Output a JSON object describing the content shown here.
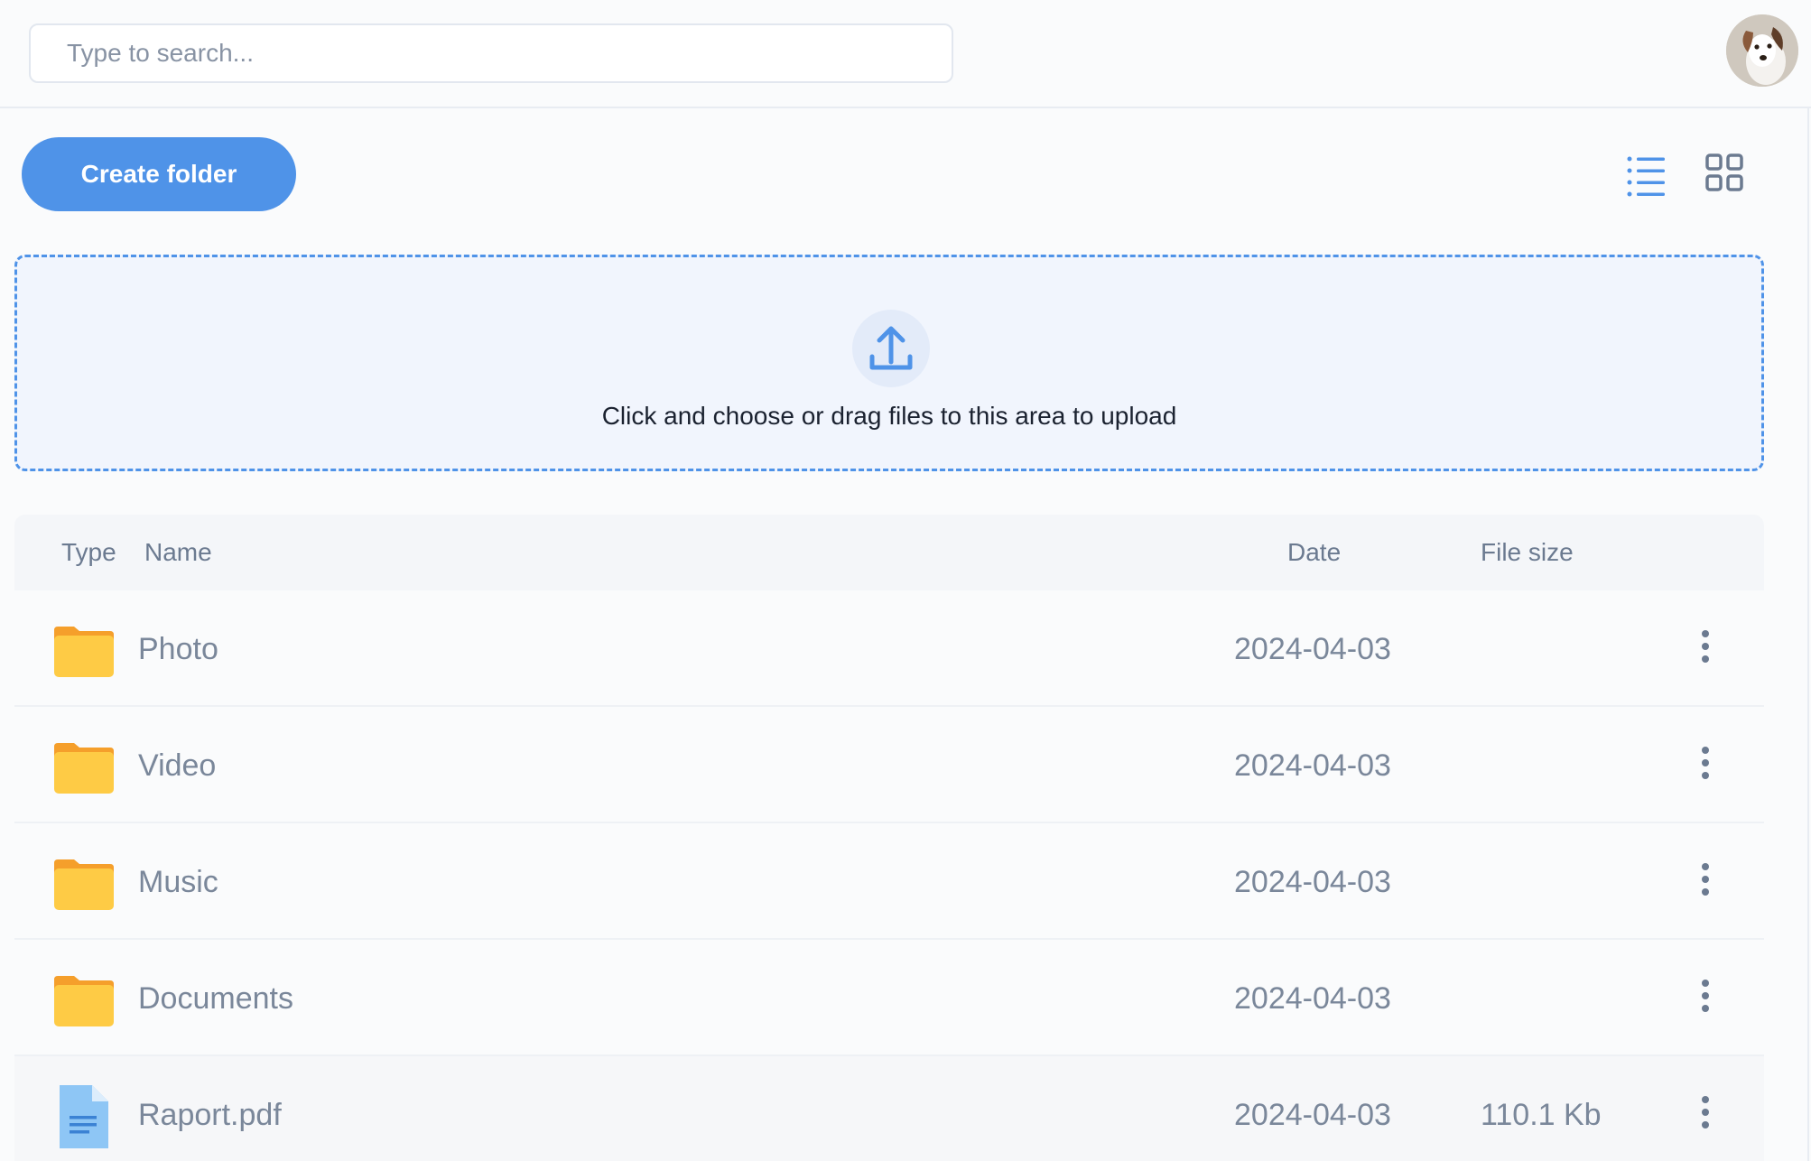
{
  "search": {
    "placeholder": "Type to search..."
  },
  "toolbar": {
    "create_folder_label": "Create folder"
  },
  "upload": {
    "text": "Click and choose or drag files to this area to upload"
  },
  "table": {
    "headers": {
      "type": "Type",
      "name": "Name",
      "date": "Date",
      "size": "File size"
    },
    "rows": [
      {
        "kind": "folder",
        "name": "Photo",
        "date": "2024-04-03",
        "size": ""
      },
      {
        "kind": "folder",
        "name": "Video",
        "date": "2024-04-03",
        "size": ""
      },
      {
        "kind": "folder",
        "name": "Music",
        "date": "2024-04-03",
        "size": ""
      },
      {
        "kind": "folder",
        "name": "Documents",
        "date": "2024-04-03",
        "size": ""
      },
      {
        "kind": "file",
        "name": "Raport.pdf",
        "date": "2024-04-03",
        "size": "110.1 Kb"
      }
    ]
  },
  "colors": {
    "accent": "#4f93e8",
    "folder": "#fecb45",
    "folder_tab": "#f59f2b",
    "file": "#8ec6f5"
  },
  "icons": {
    "list_view": "list-view-icon",
    "grid_view": "grid-view-icon",
    "upload": "upload-icon",
    "folder": "folder-icon",
    "file": "document-icon",
    "more": "more-vertical-icon"
  }
}
